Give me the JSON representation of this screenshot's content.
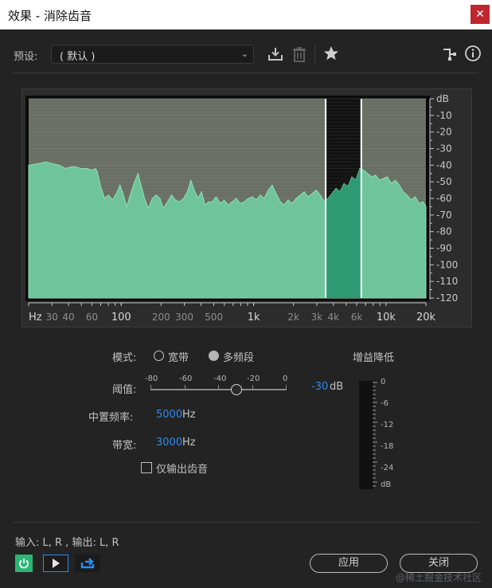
{
  "window": {
    "title": "效果 - 消除齿音",
    "close_glyph": "✕"
  },
  "preset": {
    "label": "预设:",
    "value": "( 默认 )"
  },
  "graph": {
    "db_labels": [
      "dB",
      "-10",
      "-20",
      "-30",
      "-40",
      "-50",
      "-60",
      "-70",
      "-80",
      "-90",
      "-100",
      "-110",
      "-120"
    ],
    "freq_labels": [
      {
        "t": "Hz",
        "f": null
      },
      {
        "t": "30",
        "f": 30
      },
      {
        "t": "40",
        "f": 40
      },
      {
        "t": "60",
        "f": 60
      },
      {
        "t": "100",
        "f": 100
      },
      {
        "t": "200",
        "f": 200
      },
      {
        "t": "300",
        "f": 300
      },
      {
        "t": "500",
        "f": 500
      },
      {
        "t": "1k",
        "f": 1000
      },
      {
        "t": "2k",
        "f": 2000
      },
      {
        "t": "3k",
        "f": 3000
      },
      {
        "t": "4k",
        "f": 4000
      },
      {
        "t": "6k",
        "f": 6000
      },
      {
        "t": "10k",
        "f": 10000
      },
      {
        "t": "20k",
        "f": 20000
      }
    ],
    "band_low_hz": 3500,
    "band_high_hz": 6500,
    "spectrum_db": [
      [
        20,
        -40
      ],
      [
        24,
        -39
      ],
      [
        27,
        -38
      ],
      [
        30,
        -39
      ],
      [
        34,
        -40
      ],
      [
        38,
        -42
      ],
      [
        42,
        -41
      ],
      [
        45,
        -41
      ],
      [
        50,
        -42
      ],
      [
        55,
        -42
      ],
      [
        60,
        -43
      ],
      [
        64,
        -42
      ],
      [
        66,
        -44
      ],
      [
        70,
        -53
      ],
      [
        75,
        -60
      ],
      [
        80,
        -58
      ],
      [
        86,
        -61
      ],
      [
        92,
        -57
      ],
      [
        98,
        -52
      ],
      [
        104,
        -58
      ],
      [
        110,
        -65
      ],
      [
        118,
        -57
      ],
      [
        126,
        -50
      ],
      [
        134,
        -45
      ],
      [
        140,
        -51
      ],
      [
        150,
        -60
      ],
      [
        160,
        -66
      ],
      [
        172,
        -60
      ],
      [
        184,
        -58
      ],
      [
        196,
        -60
      ],
      [
        208,
        -66
      ],
      [
        224,
        -62
      ],
      [
        240,
        -58
      ],
      [
        256,
        -61
      ],
      [
        276,
        -62
      ],
      [
        296,
        -60
      ],
      [
        316,
        -56
      ],
      [
        336,
        -49
      ],
      [
        356,
        -55
      ],
      [
        380,
        -60
      ],
      [
        404,
        -56
      ],
      [
        430,
        -64
      ],
      [
        456,
        -62
      ],
      [
        488,
        -62
      ],
      [
        520,
        -59
      ],
      [
        560,
        -63
      ],
      [
        600,
        -61
      ],
      [
        640,
        -64
      ],
      [
        690,
        -62
      ],
      [
        740,
        -60
      ],
      [
        790,
        -63
      ],
      [
        850,
        -62
      ],
      [
        910,
        -60
      ],
      [
        980,
        -59
      ],
      [
        1050,
        -61
      ],
      [
        1120,
        -58
      ],
      [
        1200,
        -60
      ],
      [
        1290,
        -55
      ],
      [
        1380,
        -52
      ],
      [
        1480,
        -57
      ],
      [
        1590,
        -62
      ],
      [
        1700,
        -64
      ],
      [
        1820,
        -61
      ],
      [
        1950,
        -63
      ],
      [
        2100,
        -60
      ],
      [
        2250,
        -58
      ],
      [
        2410,
        -56
      ],
      [
        2580,
        -59
      ],
      [
        2770,
        -57
      ],
      [
        2970,
        -55
      ],
      [
        3180,
        -58
      ],
      [
        3410,
        -62
      ],
      [
        3650,
        -60
      ],
      [
        3910,
        -57
      ],
      [
        4190,
        -54
      ],
      [
        4490,
        -56
      ],
      [
        4810,
        -51
      ],
      [
        5150,
        -53
      ],
      [
        5520,
        -47
      ],
      [
        5910,
        -49
      ],
      [
        6330,
        -42
      ],
      [
        6780,
        -43
      ],
      [
        7260,
        -45
      ],
      [
        7780,
        -47
      ],
      [
        8330,
        -46
      ],
      [
        8920,
        -49
      ],
      [
        9560,
        -48
      ],
      [
        10240,
        -47
      ],
      [
        10970,
        -51
      ],
      [
        11750,
        -49
      ],
      [
        12590,
        -52
      ],
      [
        13490,
        -56
      ],
      [
        14450,
        -58
      ],
      [
        15480,
        -61
      ],
      [
        16580,
        -59
      ],
      [
        17760,
        -63
      ],
      [
        19020,
        -62
      ],
      [
        20000,
        -65
      ]
    ]
  },
  "mode": {
    "label": "模式:",
    "opt1": "宽带",
    "opt2": "多频段",
    "selected": "多频段"
  },
  "threshold": {
    "label": "阈值:",
    "scale": [
      "-80",
      "-60",
      "-40",
      "-20",
      "0"
    ],
    "value": "-30",
    "unit": "dB",
    "level_db": -30,
    "min_db": -80,
    "max_db": 0
  },
  "center_freq": {
    "label": "中置频率:",
    "value": "5000",
    "unit": "Hz"
  },
  "bandwidth": {
    "label": "带宽:",
    "value": "3000",
    "unit": "Hz"
  },
  "output_only": {
    "label": "仅输出齿音",
    "checked": false
  },
  "gain_reduction": {
    "label": "增益降低",
    "scale": [
      "0",
      "-6",
      "-12",
      "-18",
      "-24",
      "dB"
    ]
  },
  "io": {
    "text": "输入: L, R , 输出: L, R"
  },
  "buttons": {
    "apply": "应用",
    "close": "关闭"
  },
  "watermark": "@稀土掘金技术社区",
  "colors": {
    "accent_blue": "#2d8cf0",
    "spectrum_fill": "#6fc49c",
    "spectrum_band": "#2e9a74",
    "power_green": "#2bb673"
  }
}
